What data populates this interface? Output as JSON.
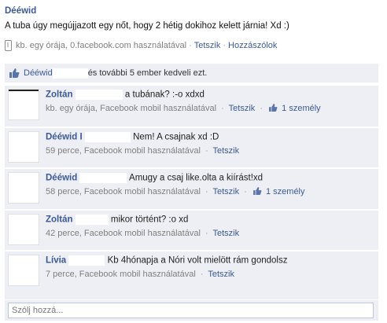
{
  "post": {
    "author": "Dééwid",
    "text": "A tuba úgy megújjazott egy nőt, hogy 2 hétig dokihoz kelett járnia! Xd :)",
    "time": "kb. egy órája, 0.facebook.com használatával",
    "like_label": "Tetszik",
    "comment_label": "Hozzászólok"
  },
  "likes": {
    "name": "Dééwid",
    "text": "és további 5 ember kedveli ezt."
  },
  "comments": [
    {
      "author": "Zoltán",
      "text": "a tubának? :-o xdxd",
      "time": "kb. egy órája, Facebook mobil használatával",
      "like_label": "Tetszik",
      "like_count": "1 személy"
    },
    {
      "author": "Dééwid I",
      "text": "Nem! A csajnak xd :D",
      "time": "59 perce, Facebook mobil használatával",
      "like_label": "Tetszik",
      "like_count": ""
    },
    {
      "author": "Dééwid",
      "text": "Amugy a csaj like.olta a kiírást!xd",
      "time": "58 perce, Facebook mobil használatával",
      "like_label": "Tetszik",
      "like_count": "1 személy"
    },
    {
      "author": "Zoltán",
      "text": "mikor történt? :o xd",
      "time": "42 perce, Facebook mobil használatával",
      "like_label": "Tetszik",
      "like_count": ""
    },
    {
      "author": "Lívia",
      "text": "Kb 4hónapja a Nóri volt mielött rám gondolsz",
      "time": "7 perce, Facebook mobil használatával",
      "like_label": "Tetszik",
      "like_count": ""
    }
  ],
  "reply": {
    "placeholder": "Szólj hozzá..."
  },
  "colors": {
    "link": "#3b5998",
    "panel": "#edeff4",
    "meta": "#7f7f7f"
  },
  "icons": [
    "mobile-phone-icon",
    "thumbs-up-icon"
  ]
}
